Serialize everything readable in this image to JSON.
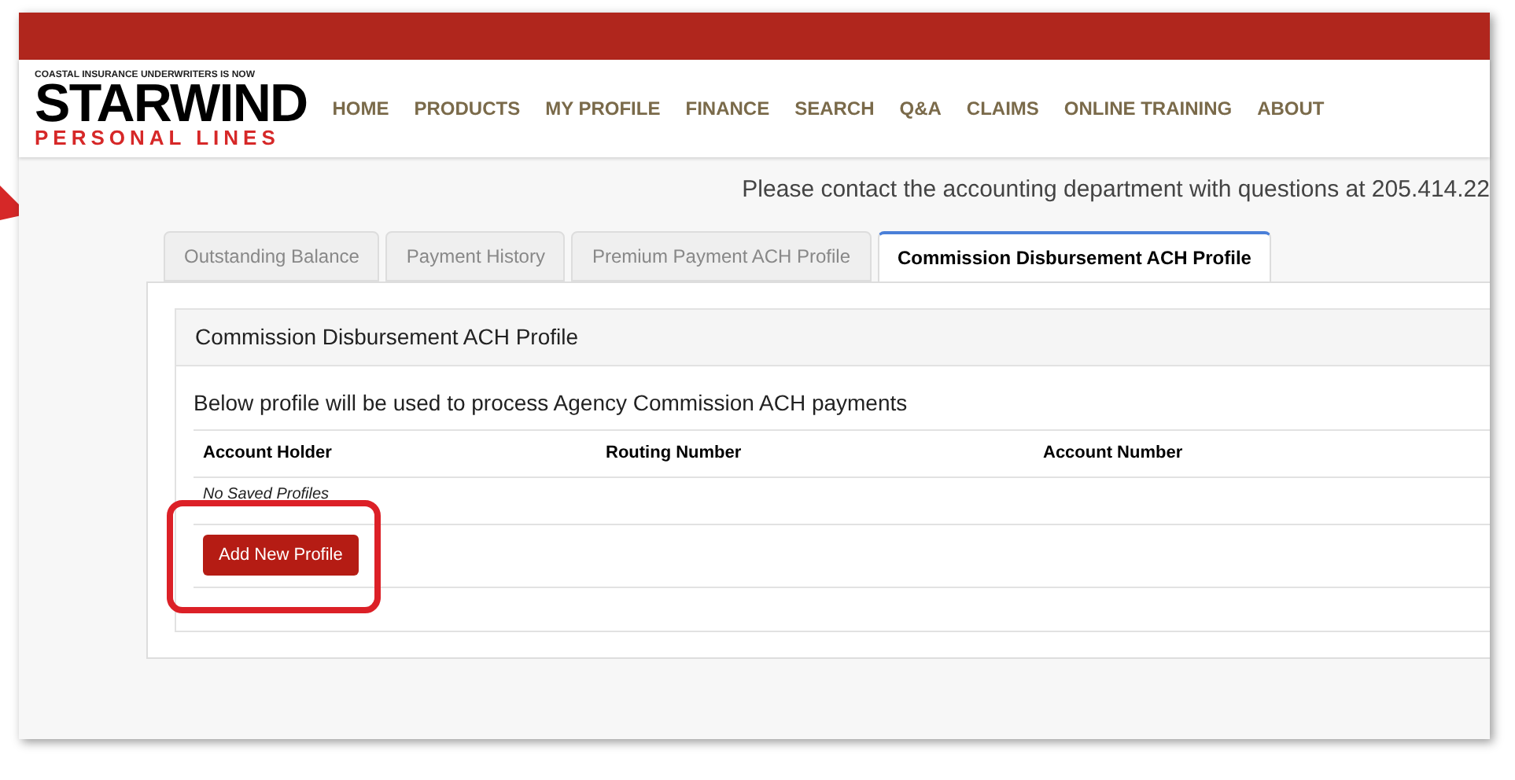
{
  "logo": {
    "tagline": "COASTAL INSURANCE UNDERWRITERS IS NOW",
    "name": "STARWIND",
    "subtitle": "PERSONAL LINES"
  },
  "nav": [
    "HOME",
    "PRODUCTS",
    "MY PROFILE",
    "FINANCE",
    "SEARCH",
    "Q&A",
    "CLAIMS",
    "ONLINE TRAINING",
    "ABOUT"
  ],
  "notice": "Please contact the accounting department with questions at 205.414.22",
  "tabs": [
    {
      "label": "Outstanding Balance",
      "selected": false
    },
    {
      "label": "Payment History",
      "selected": false
    },
    {
      "label": "Premium Payment ACH Profile",
      "selected": false
    },
    {
      "label": "Commission Disbursement ACH Profile",
      "selected": true
    }
  ],
  "panel": {
    "title": "Commission Disbursement ACH Profile",
    "description": "Below profile will be used to process Agency Commission ACH payments",
    "columns": [
      "Account Holder",
      "Routing Number",
      "Account Number"
    ],
    "empty_message": "No Saved Profiles",
    "button": "Add New Profile"
  }
}
